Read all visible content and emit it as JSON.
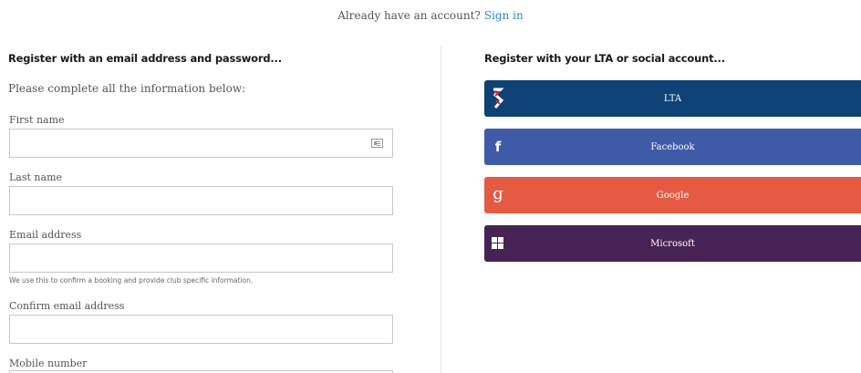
{
  "header": {
    "prompt": "Already have an account?",
    "signin_link": "Sign in"
  },
  "email_section": {
    "heading": "Register with an email address and password...",
    "intro": "Please complete all the information below:",
    "fields": {
      "first_name": {
        "label": "First name",
        "value": ""
      },
      "last_name": {
        "label": "Last name",
        "value": ""
      },
      "email": {
        "label": "Email address",
        "value": "",
        "help": "We use this to confirm a booking and provide club specific information."
      },
      "confirm_email": {
        "label": "Confirm email address",
        "value": ""
      },
      "mobile": {
        "label": "Mobile number",
        "value": ""
      }
    }
  },
  "social_section": {
    "heading": "Register with your LTA or social account...",
    "buttons": {
      "lta": {
        "label": "LTA",
        "color": "#0e4275",
        "icon": "lta-logo-icon"
      },
      "facebook": {
        "label": "Facebook",
        "color": "#3f5ba8",
        "icon": "facebook-icon"
      },
      "google": {
        "label": "Google",
        "color": "#e55a43",
        "icon": "google-icon"
      },
      "microsoft": {
        "label": "Microsoft",
        "color": "#472355",
        "icon": "windows-icon"
      }
    }
  },
  "colors": {
    "link": "#2b8ccf",
    "border": "#c8c8c8"
  }
}
